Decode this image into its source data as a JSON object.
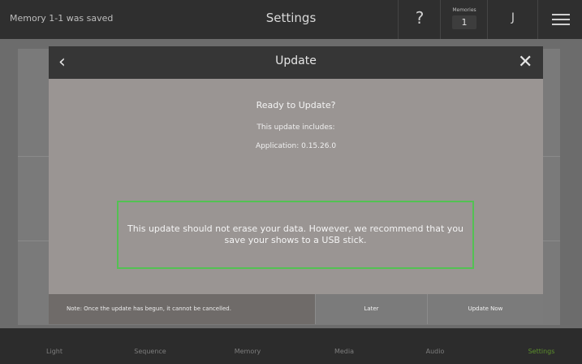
{
  "topbar": {
    "status": "Memory 1-1 was saved",
    "title": "Settings",
    "help_label": "?",
    "memories_label": "Memories",
    "memories_value": "1",
    "j_label": "J",
    "menu_icon": "hamburger-menu-icon"
  },
  "dialog": {
    "title": "Update",
    "back_icon": "‹",
    "close_icon": "✕",
    "heading": "Ready to Update?",
    "includes_label": "This update includes:",
    "application": "Application: 0.15.26.0",
    "notice": "This update should not erase your data. However, we recommend that you save your shows to a USB stick.",
    "footer_note": "Note: Once the update has begun, it cannot be cancelled.",
    "later_label": "Later",
    "update_now_label": "Update Now",
    "notice_border_color": "#53c153"
  },
  "bottom_nav": {
    "items": [
      {
        "label": "Light"
      },
      {
        "label": "Sequence"
      },
      {
        "label": "Memory"
      },
      {
        "label": "Media"
      },
      {
        "label": "Audio"
      },
      {
        "label": "Settings"
      }
    ],
    "active": "Settings",
    "active_color": "#5c8f2b"
  }
}
